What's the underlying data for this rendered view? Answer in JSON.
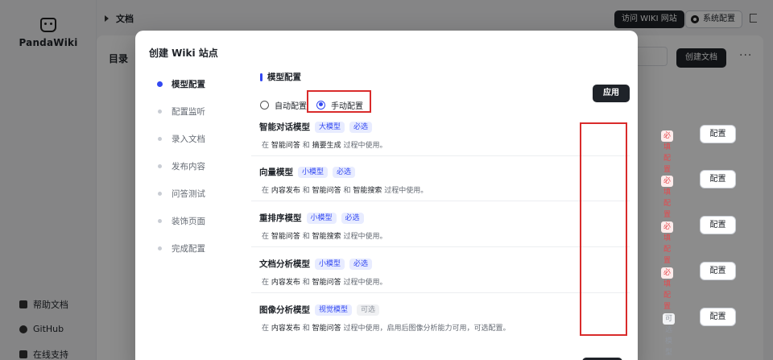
{
  "app": {
    "logo_text": "PandaWiki",
    "breadcrumb": "文档",
    "visit_wiki_label": "访问 WIKI 网站",
    "system_config_label": "系统配置",
    "toc_title": "目录",
    "create_doc_label": "创建文档",
    "sidebar_links": [
      {
        "label": "帮助文档",
        "icon": "document-icon"
      },
      {
        "label": "GitHub",
        "icon": "github-icon"
      },
      {
        "label": "在线支持",
        "icon": "support-icon"
      }
    ]
  },
  "modal": {
    "title": "创建 Wiki 站点",
    "steps": [
      {
        "label": "模型配置",
        "active": true
      },
      {
        "label": "配置监听",
        "active": false
      },
      {
        "label": "录入文档",
        "active": false
      },
      {
        "label": "发布内容",
        "active": false
      },
      {
        "label": "问答测试",
        "active": false
      },
      {
        "label": "装饰页面",
        "active": false
      },
      {
        "label": "完成配置",
        "active": false
      }
    ],
    "section_title": "模型配置",
    "radio_auto": "自动配置",
    "radio_manual": "手动配置",
    "selected_mode": "手动配置",
    "apply_label": "应用",
    "models": [
      {
        "name": "智能对话模型",
        "tag": "大模型",
        "badge": "必选",
        "desc_pre": "在 ",
        "desc_h1": "智能问答",
        "desc_mid1": " 和 ",
        "desc_h2": "摘要生成",
        "desc_mid2": "",
        "desc_h3": "",
        "desc_post": " 过程中使用。",
        "status": "必填配置",
        "button": "配置"
      },
      {
        "name": "向量模型",
        "tag": "小模型",
        "badge": "必选",
        "desc_pre": "在 ",
        "desc_h1": "内容发布",
        "desc_mid1": " 和 ",
        "desc_h2": "智能问答",
        "desc_mid2": " 和 ",
        "desc_h3": "智能搜索",
        "desc_post": " 过程中使用。",
        "status": "必填配置",
        "button": "配置"
      },
      {
        "name": "重排序模型",
        "tag": "小模型",
        "badge": "必选",
        "desc_pre": "在 ",
        "desc_h1": "智能问答",
        "desc_mid1": " 和 ",
        "desc_h2": "智能搜索",
        "desc_mid2": "",
        "desc_h3": "",
        "desc_post": " 过程中使用。",
        "status": "必填配置",
        "button": "配置"
      },
      {
        "name": "文档分析模型",
        "tag": "小模型",
        "badge": "必选",
        "desc_pre": "在 ",
        "desc_h1": "内容发布",
        "desc_mid1": " 和 ",
        "desc_h2": "智能问答",
        "desc_mid2": "",
        "desc_h3": "",
        "desc_post": " 过程中使用。",
        "status": "必填配置",
        "button": "配置"
      },
      {
        "name": "图像分析模型",
        "tag": "视觉模型",
        "badge": "可选",
        "desc_pre": "在 ",
        "desc_h1": "内容发布",
        "desc_mid1": " 和 ",
        "desc_h2": "智能问答",
        "desc_mid2": "",
        "desc_h3": "",
        "desc_post": " 过程中使用，启用后图像分析能力可用，可选配置。",
        "status": "可选模型",
        "button": "配置"
      }
    ]
  },
  "colors": {
    "accent": "#3248f2",
    "highlight_box": "#d92b2b",
    "required": "#e5484d"
  }
}
